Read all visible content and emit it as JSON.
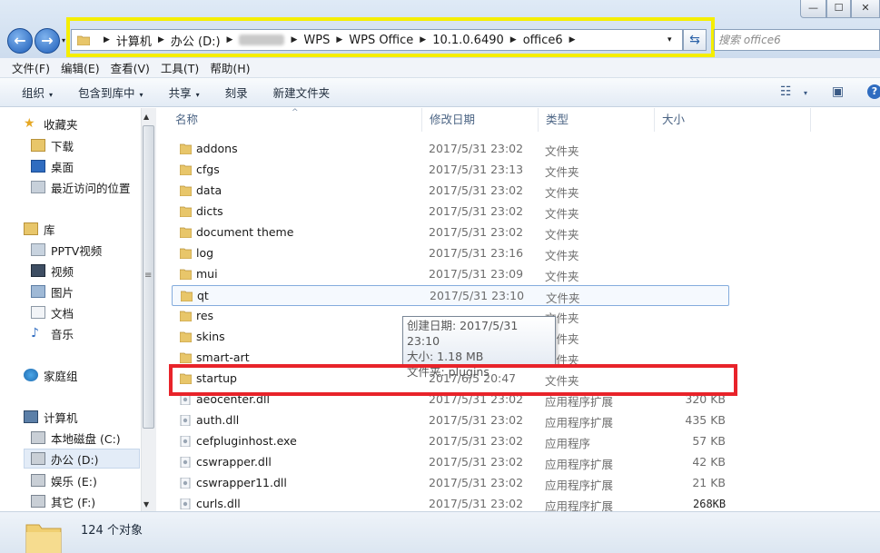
{
  "window": {
    "minimize_glyph": "—",
    "maximize_glyph": "☐",
    "close_glyph": "✕"
  },
  "nav": {
    "back_glyph": "←",
    "forward_glyph": "→",
    "dropdown_glyph": "▾"
  },
  "address": {
    "segments": [
      "计算机",
      "办公 (D:)",
      "",
      "WPS",
      "WPS Office",
      "10.1.0.6490",
      "office6"
    ],
    "dropdown_glyph": "▾",
    "refresh_glyph": "⇆"
  },
  "search": {
    "placeholder": "搜索 office6"
  },
  "menu": [
    "文件(F)",
    "编辑(E)",
    "查看(V)",
    "工具(T)",
    "帮助(H)"
  ],
  "toolbar": {
    "organize": "组织",
    "include_in_library": "包含到库中",
    "share": "共享",
    "burn": "刻录",
    "new_folder": "新建文件夹",
    "caret": "▾",
    "view_glyph": "☷",
    "view_caret": "▾",
    "preview_glyph": "▣",
    "help_glyph": "?"
  },
  "sidebar": {
    "favorites": "收藏夹",
    "downloads": "下载",
    "desktop": "桌面",
    "recent": "最近访问的位置",
    "libraries": "库",
    "pptv": "PPTV视频",
    "videos": "视频",
    "pictures": "图片",
    "documents": "文档",
    "music": "音乐",
    "homegroup": "家庭组",
    "computer": "计算机",
    "local_c": "本地磁盘 (C:)",
    "office_d": "办公 (D:)",
    "entertainment_e": "娱乐 (E:)",
    "other_f": "其它 (F:)",
    "scroll_up": "▲",
    "scroll_down": "▼",
    "grip": "≡"
  },
  "columns": {
    "name": "名称",
    "modified": "修改日期",
    "type": "类型",
    "size": "大小",
    "sort_glyph": "^"
  },
  "files": [
    {
      "name": "addons",
      "date": "2017/5/31 23:02",
      "type": "文件夹",
      "size": ""
    },
    {
      "name": "cfgs",
      "date": "2017/5/31 23:13",
      "type": "文件夹",
      "size": ""
    },
    {
      "name": "data",
      "date": "2017/5/31 23:02",
      "type": "文件夹",
      "size": ""
    },
    {
      "name": "dicts",
      "date": "2017/5/31 23:02",
      "type": "文件夹",
      "size": ""
    },
    {
      "name": "document theme",
      "date": "2017/5/31 23:02",
      "type": "文件夹",
      "size": ""
    },
    {
      "name": "log",
      "date": "2017/5/31 23:16",
      "type": "文件夹",
      "size": ""
    },
    {
      "name": "mui",
      "date": "2017/5/31 23:09",
      "type": "文件夹",
      "size": ""
    },
    {
      "name": "qt",
      "date": "2017/5/31 23:10",
      "type": "文件夹",
      "size": ""
    },
    {
      "name": "res",
      "date": "",
      "type": "文件夹",
      "size": ""
    },
    {
      "name": "skins",
      "date": "",
      "type": "文件夹",
      "size": ""
    },
    {
      "name": "smart-art",
      "date": "",
      "type": "文件夹",
      "size": ""
    },
    {
      "name": "startup",
      "date": "2017/6/5 20:47",
      "type": "文件夹",
      "size": ""
    },
    {
      "name": "aeocenter.dll",
      "date": "2017/5/31 23:02",
      "type": "应用程序扩展",
      "size": "320 KB"
    },
    {
      "name": "auth.dll",
      "date": "2017/5/31 23:02",
      "type": "应用程序扩展",
      "size": "435 KB"
    },
    {
      "name": "cefpluginhost.exe",
      "date": "2017/5/31 23:02",
      "type": "应用程序",
      "size": "57 KB"
    },
    {
      "name": "cswrapper.dll",
      "date": "2017/5/31 23:02",
      "type": "应用程序扩展",
      "size": "42 KB"
    },
    {
      "name": "cswrapper11.dll",
      "date": "2017/5/31 23:02",
      "type": "应用程序扩展",
      "size": "21 KB"
    },
    {
      "name": "curls.dll",
      "date": "2017/5/31 23:02",
      "type": "应用程序扩展",
      "size": ""
    }
  ],
  "tooltip": {
    "created": "创建日期: 2017/5/31 23:10",
    "size": "大小: 1.18 MB",
    "folders": "文件夹: plugins"
  },
  "floating_size": "268KB",
  "status": {
    "count": "124 个对象"
  }
}
